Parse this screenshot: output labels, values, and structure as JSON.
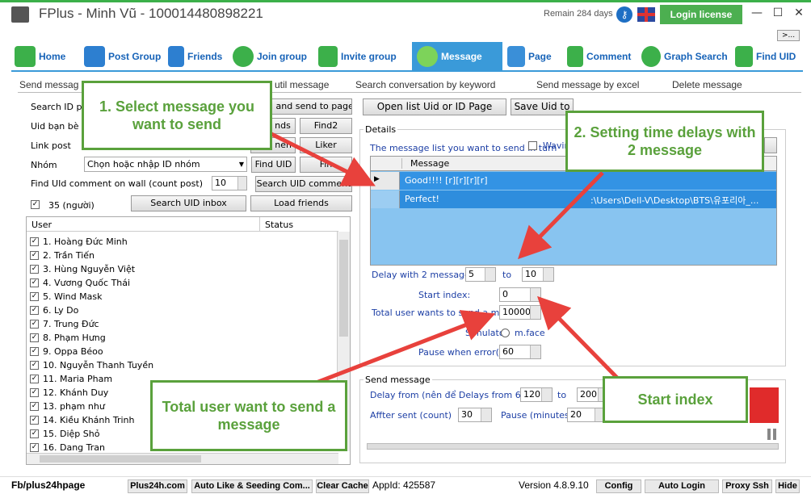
{
  "window": {
    "title": "FPlus - Minh Vũ - 100014480898221",
    "remain": "Remain 284 days",
    "login_license": "Login license",
    "more": ">..."
  },
  "nav": [
    "Home",
    "Post Group",
    "Friends",
    "Join group",
    "Invite group",
    "Message",
    "Page",
    "Comment",
    "Graph Search",
    "Find UID"
  ],
  "subtabs": [
    "Send messag",
    "util message",
    "Search conversation by keyword",
    "Send message by excel",
    "Delete message"
  ],
  "left": {
    "search_id_label": "Search ID pa",
    "send_to_page_btn": "l and send to page",
    "uid_friends_label": "Uid bạn bè",
    "friends_btn": "nds",
    "find2_btn": "Find2",
    "link_post_label": "Link post",
    "comment_btn": "nen",
    "liker_btn": "Liker",
    "group_label": "Nhóm",
    "group_select": "Chọn hoặc nhập ID nhóm",
    "find_uid_btn": "Find UID",
    "find_btn": "Fin",
    "find_uid_comment_label": "Find UId comment on wall (count post)",
    "count_post_value": "10",
    "search_uid_comment_btn": "Search UID comment",
    "count_people": "35 (người)",
    "search_uid_inbox_btn": "Search UID inbox",
    "load_friends_btn": "Load friends",
    "col_user": "User",
    "col_status": "Status",
    "users": [
      "1. Hoàng Đức Minh",
      "2. Trần Tiến",
      "3. Hùng Nguyễn Việt",
      "4. Vương Quốc Thái",
      "5. Wind Mask",
      "6. Ly Do",
      "7. Trung Đức",
      "8. Phạm Hưng",
      "9. Oppa Béoo",
      "10. Nguyễn Thanh Tuyền",
      "11. Maria Pham",
      "12. Khánh Duy",
      "13. phạm như",
      "14. Kiều Khánh Trinh",
      "15. Diệp Shỏ",
      "16. Dang Tran"
    ]
  },
  "right": {
    "open_list_btn": "Open list Uid or ID Page",
    "save_uid_btn": "Save Uid to",
    "details_label": "Details",
    "message_list_label": "The message list you want to send in turn",
    "waving_label": "Wavin",
    "grid_col_message": "Message",
    "messages": [
      {
        "text": "Good!!!! [r][r][r][r]",
        "path": ""
      },
      {
        "text": "Perfect!",
        "path": ":\\Users\\Dell-V\\Desktop\\BTS\\유포리아_..."
      }
    ],
    "delay_label": "Delay with 2 message:",
    "delay_from": "5",
    "delay_to_label": "to",
    "delay_to": "10",
    "start_index_label": "Start index:",
    "start_index": "0",
    "total_user_label": "Total user wants to send a messa",
    "total_user": "10000",
    "simulator_label": "Simulator",
    "mface_label": "m.face",
    "pause_error_label": "Pause when error(m)",
    "pause_error": "60",
    "send_message_label": "Send message",
    "delay_from_label": "Delay from (nên để Delays from 60> 120",
    "delay_from_value": "120",
    "delay_from_to_label": "to",
    "delay_from_to": "200",
    "after_sent_label": "Affter sent (count)",
    "after_sent": "30",
    "pause_minutes_label": "Pause (minutes)",
    "pause_minutes": "20"
  },
  "statusbar": {
    "page": "Fb/plus24hpage",
    "plus24h": "Plus24h.com",
    "auto_like": "Auto Like & Seeding Com...",
    "clear_cache": "Clear Cache",
    "appid": "AppId: 425587",
    "version": "Version 4.8.9.10",
    "config": "Config",
    "auto_login": "Auto Login",
    "proxy_ssh": "Proxy Ssh",
    "hide": "Hide"
  },
  "annotations": {
    "callout1": "1. Select message you want to send",
    "callout2": "2. Setting time delays with 2 message",
    "callout3": "Total user want to send a message",
    "callout4": "Start index"
  },
  "colors": {
    "accent_green": "#5aa13c",
    "nav_blue": "#1763b8",
    "active_tab": "#3a9ad9",
    "arrow_red": "#e8413c"
  }
}
